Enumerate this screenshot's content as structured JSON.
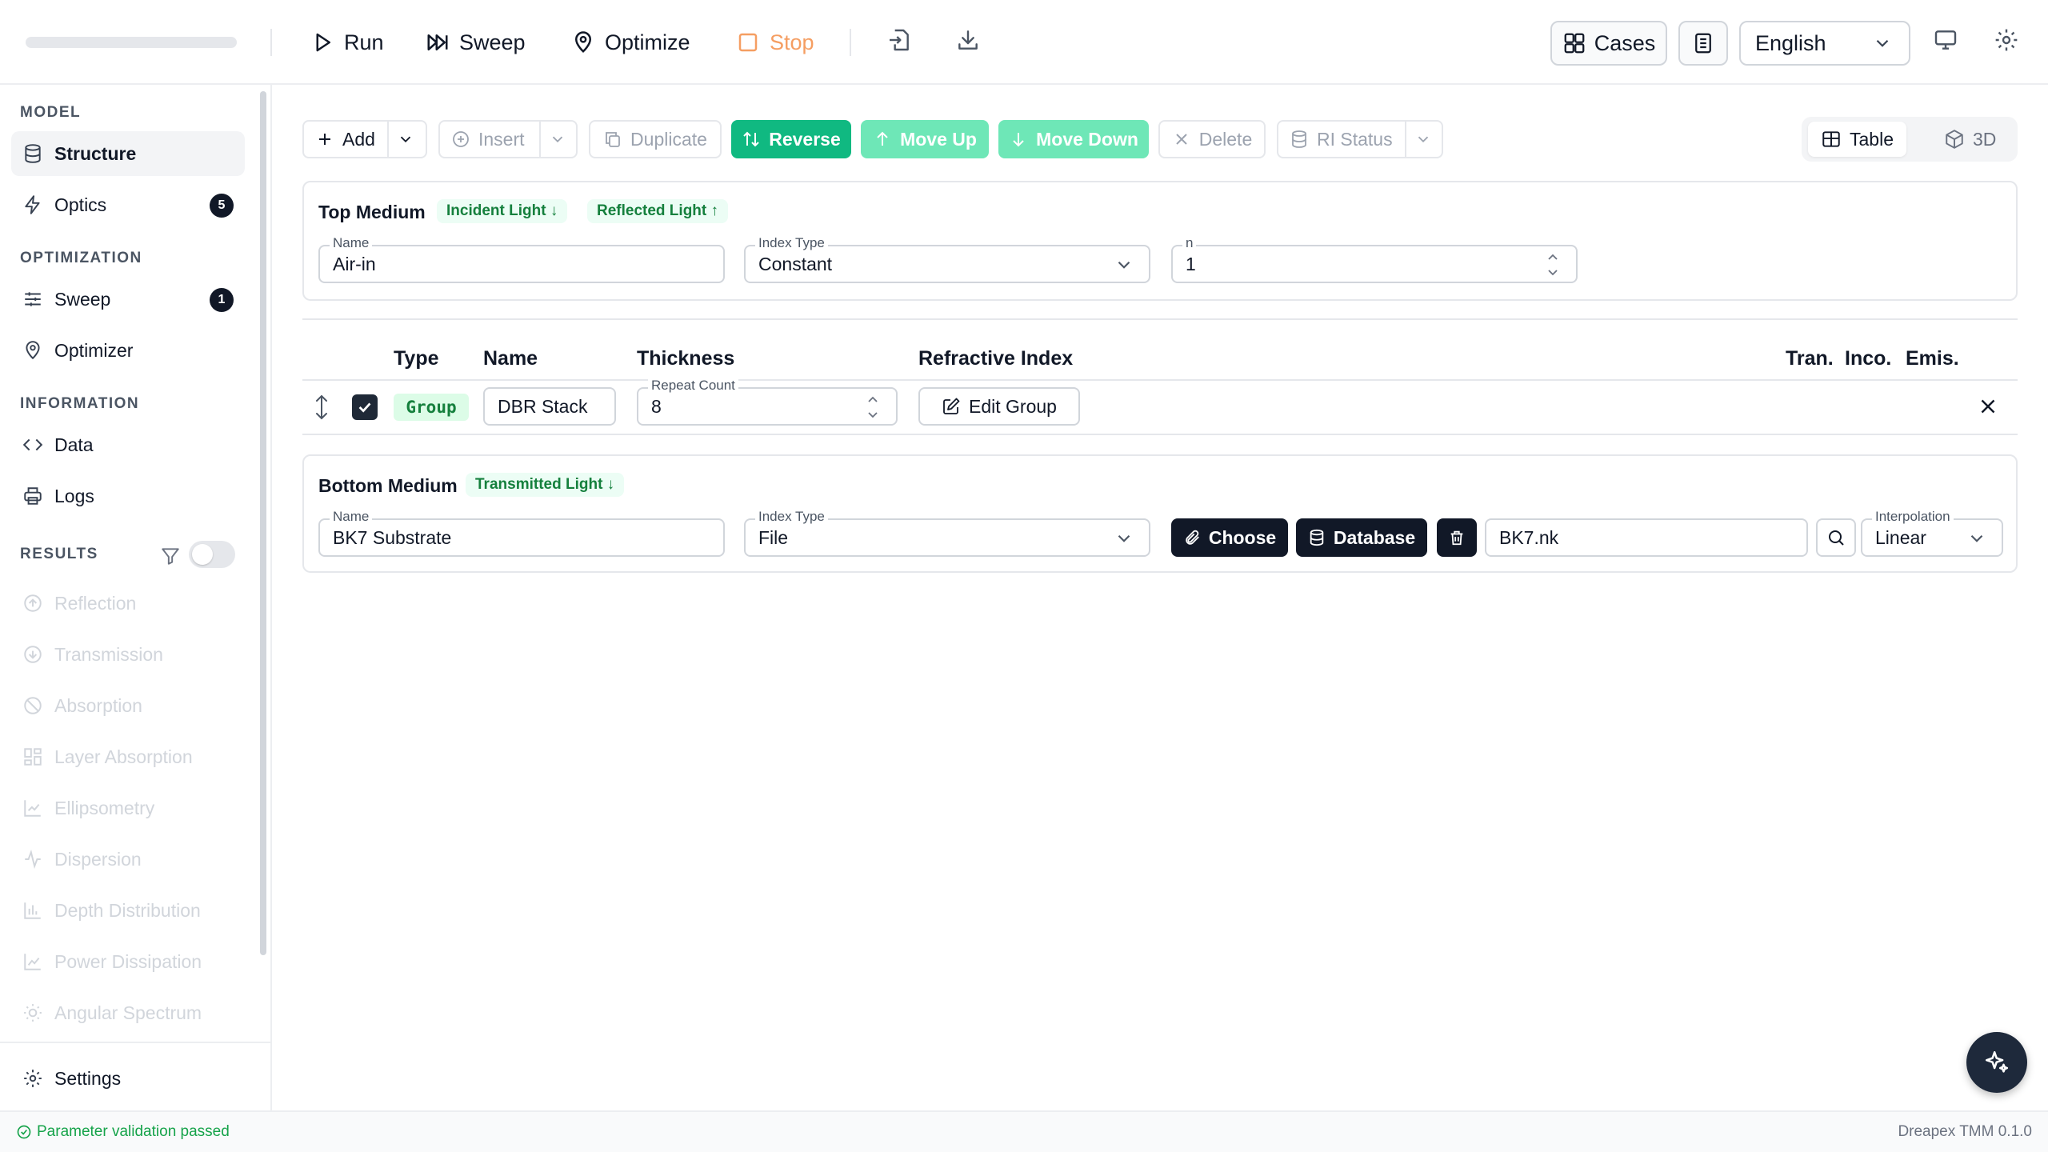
{
  "toolbar": {
    "run": "Run",
    "sweep": "Sweep",
    "optimize": "Optimize",
    "stop": "Stop",
    "cases": "Cases",
    "language": "English"
  },
  "sidebar": {
    "sections": {
      "model": "MODEL",
      "optimization": "OPTIMIZATION",
      "information": "INFORMATION",
      "results": "RESULTS"
    },
    "items": {
      "structure": "Structure",
      "optics": "Optics",
      "optics_badge": "5",
      "sweep": "Sweep",
      "sweep_badge": "1",
      "optimizer": "Optimizer",
      "data": "Data",
      "logs": "Logs",
      "reflection": "Reflection",
      "transmission": "Transmission",
      "absorption": "Absorption",
      "layer_absorption": "Layer Absorption",
      "ellipsometry": "Ellipsometry",
      "dispersion": "Dispersion",
      "depth_distribution": "Depth Distribution",
      "power_dissipation": "Power Dissipation",
      "angular_spectrum": "Angular Spectrum",
      "settings": "Settings"
    },
    "results_filter_on": false
  },
  "actions": {
    "add": "Add",
    "insert": "Insert",
    "duplicate": "Duplicate",
    "reverse": "Reverse",
    "move_up": "Move Up",
    "move_down": "Move Down",
    "delete": "Delete",
    "ri_status": "RI Status",
    "view_table": "Table",
    "view_3d": "3D",
    "active_view": "Table"
  },
  "top_medium": {
    "title": "Top Medium",
    "tag_incident": "Incident Light ↓",
    "tag_reflected": "Reflected Light ↑",
    "name_label": "Name",
    "name_value": "Air-in",
    "index_type_label": "Index Type",
    "index_type_value": "Constant",
    "n_label": "n",
    "n_value": "1"
  },
  "layers": {
    "headers": {
      "type": "Type",
      "name": "Name",
      "thickness": "Thickness",
      "refractive_index": "Refractive Index",
      "tran": "Tran.",
      "inco": "Inco.",
      "emis": "Emis."
    },
    "rows": [
      {
        "type": "Group",
        "name": "DBR Stack",
        "repeat_label": "Repeat Count",
        "repeat_value": "8",
        "edit_label": "Edit Group",
        "checked": true
      }
    ]
  },
  "bottom_medium": {
    "title": "Bottom Medium",
    "tag_transmitted": "Transmitted Light ↓",
    "name_label": "Name",
    "name_value": "BK7 Substrate",
    "index_type_label": "Index Type",
    "index_type_value": "File",
    "choose": "Choose",
    "database": "Database",
    "file_value": "BK7.nk",
    "interpolation_label": "Interpolation",
    "interpolation_value": "Linear"
  },
  "status": {
    "message": "Parameter validation passed",
    "version": "Dreapex TMM 0.1.0"
  },
  "colors": {
    "accent_green": "#10b981",
    "accent_green_light": "#6ee7b7",
    "stop_orange": "#f59e62",
    "dark": "#111827"
  }
}
